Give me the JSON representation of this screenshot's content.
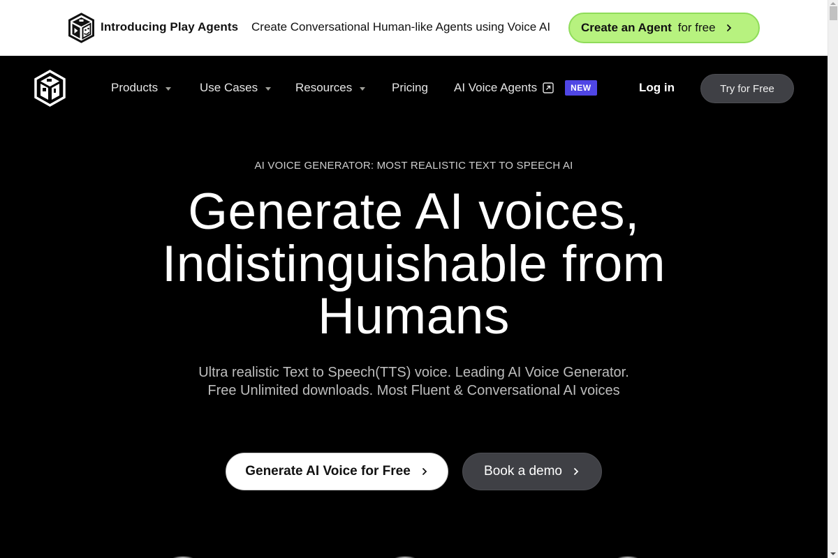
{
  "announcement": {
    "title": "Introducing Play Agents",
    "subtitle": "Create Conversational Human-like Agents using Voice AI",
    "cta_strong": "Create an Agent",
    "cta_light": "for free",
    "logo_icon": "play-agents-cube-logo",
    "cta_color": "#b7f27f"
  },
  "nav": {
    "logo_icon": "playht-cube-logo",
    "items": [
      {
        "label": "Products",
        "has_dropdown": true
      },
      {
        "label": "Use Cases",
        "has_dropdown": true
      },
      {
        "label": "Resources",
        "has_dropdown": true
      },
      {
        "label": "Pricing",
        "has_dropdown": false
      },
      {
        "label": "AI Voice Agents",
        "has_dropdown": false,
        "icon": "external-link-icon",
        "badge": "NEW"
      }
    ],
    "login_label": "Log in",
    "try_label": "Try for Free",
    "badge_color": "#4f46e5"
  },
  "hero": {
    "eyebrow": "AI VOICE GENERATOR: MOST REALISTIC TEXT TO SPEECH AI",
    "headline_lines": [
      "Generate AI voices,",
      "Indistinguishable from",
      "Humans"
    ],
    "sub_lines": [
      "Ultra realistic Text to Speech(TTS) voice. Leading AI Voice Generator.",
      "Free Unlimited downloads. Most Fluent & Conversational AI voices"
    ],
    "primary_cta": "Generate AI Voice for Free",
    "secondary_cta": "Book a demo"
  }
}
